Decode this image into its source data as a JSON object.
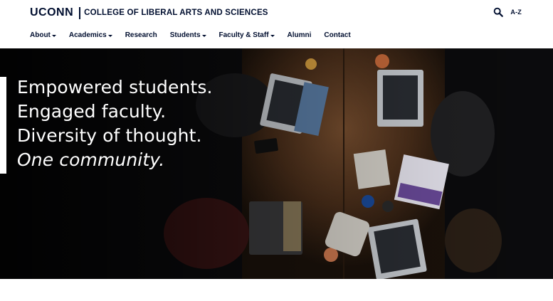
{
  "header": {
    "logo_text": "UCONN",
    "college_name": "COLLEGE OF LIBERAL ARTS AND SCIENCES",
    "az_label": "A-Z",
    "search_icon": "search-icon"
  },
  "nav": {
    "items": [
      {
        "label": "About",
        "dropdown": true
      },
      {
        "label": "Academics",
        "dropdown": true
      },
      {
        "label": "Research",
        "dropdown": false
      },
      {
        "label": "Students",
        "dropdown": true
      },
      {
        "label": "Faculty & Staff",
        "dropdown": true
      },
      {
        "label": "Alumni",
        "dropdown": false
      },
      {
        "label": "Contact",
        "dropdown": false
      }
    ]
  },
  "hero": {
    "lines": [
      "Empowered students.",
      "Engaged faculty.",
      "Diversity of thought."
    ],
    "italic_line": "One community."
  },
  "colors": {
    "brand_navy": "#000e2f",
    "hero_background": "#0b0b0d",
    "hero_text": "#ffffff",
    "table_wood": "#5a3a22"
  }
}
